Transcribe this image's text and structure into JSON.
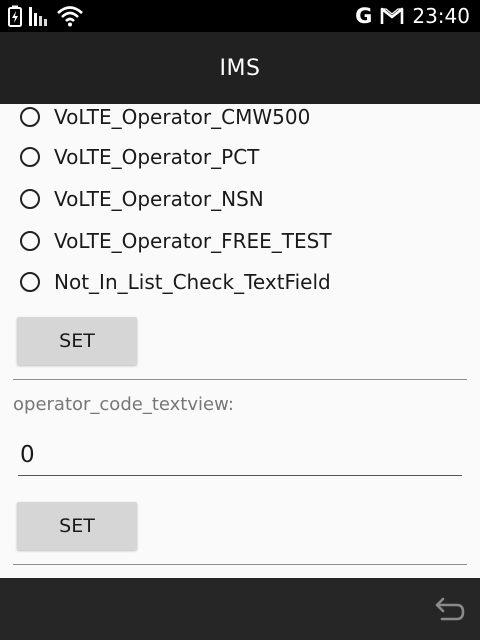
{
  "status_bar": {
    "time": "23:40",
    "left_icons": [
      "battery-charging-icon",
      "signal-bars-icon",
      "wifi-icon"
    ],
    "right_icons": [
      "google-g-icon",
      "gmail-icon"
    ],
    "google_glyph": "G"
  },
  "app_bar": {
    "title": "IMS"
  },
  "operator_options": [
    {
      "label": "VoLTE_Operator_CMW500",
      "selected": false
    },
    {
      "label": "VoLTE_Operator_PCT",
      "selected": false
    },
    {
      "label": "VoLTE_Operator_NSN",
      "selected": false
    },
    {
      "label": "VoLTE_Operator_FREE_TEST",
      "selected": false
    },
    {
      "label": "Not_In_List_Check_TextField",
      "selected": false
    }
  ],
  "set_button_1": {
    "label": "SET"
  },
  "operator_code": {
    "label": "operator_code_textview:",
    "value": "0"
  },
  "set_button_2": {
    "label": "SET"
  },
  "nav_bar": {
    "icons": [
      "back-icon"
    ]
  },
  "colors": {
    "status_bar": "#000000",
    "app_bar": "#212121",
    "content_bg": "#fafafa",
    "button_bg": "#d6d6d6",
    "nav_bar": "#262626"
  }
}
